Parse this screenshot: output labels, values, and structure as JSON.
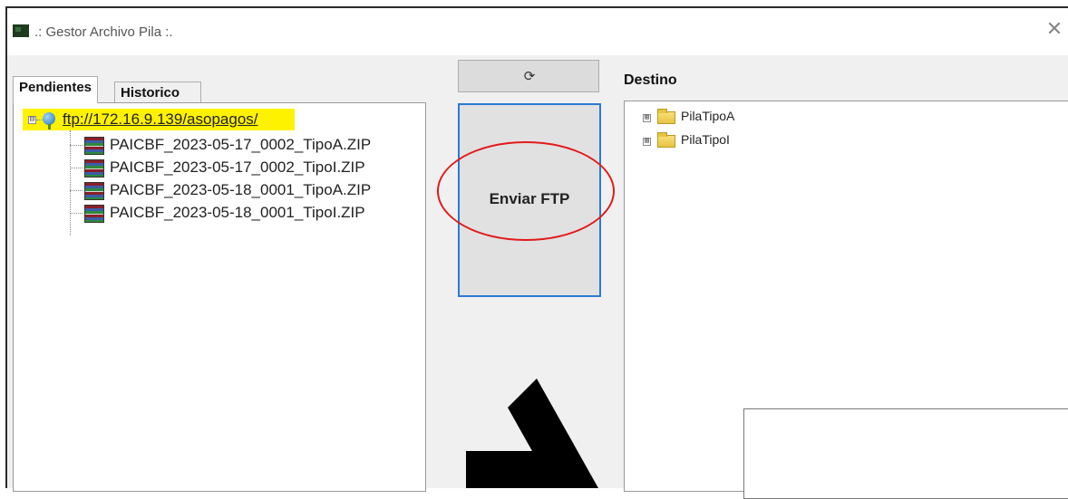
{
  "window": {
    "title": ".: Gestor Archivo Pila :.",
    "close_symbol": "✕"
  },
  "tabs": [
    {
      "label": "Pendientes",
      "active": true
    },
    {
      "label": "Historico",
      "active": false
    }
  ],
  "left_tree": {
    "root": {
      "label": "ftp://172.16.9.139/asopagos/",
      "expander": "⊟",
      "icon": "globe-icon"
    },
    "files": [
      {
        "label": "PAICBF_2023-05-17_0002_TipoA.ZIP",
        "icon": "zip-archive-icon"
      },
      {
        "label": "PAICBF_2023-05-17_0002_TipoI.ZIP",
        "icon": "zip-archive-icon"
      },
      {
        "label": "PAICBF_2023-05-18_0001_TipoA.ZIP",
        "icon": "zip-archive-icon"
      },
      {
        "label": "PAICBF_2023-05-18_0001_TipoI.ZIP",
        "icon": "zip-archive-icon"
      }
    ]
  },
  "buttons": {
    "refresh_icon": "⟳",
    "enviar_label": "Enviar FTP"
  },
  "right_tree": {
    "label": "Destino",
    "folders": [
      {
        "label": "PilaTipoA",
        "expander": "⊞"
      },
      {
        "label": "PilaTipoI",
        "expander": "⊞"
      }
    ]
  },
  "annotation_colors": {
    "highlight": "#fff200",
    "circle": "#e21a1a",
    "button_border": "#2a7ad5"
  }
}
